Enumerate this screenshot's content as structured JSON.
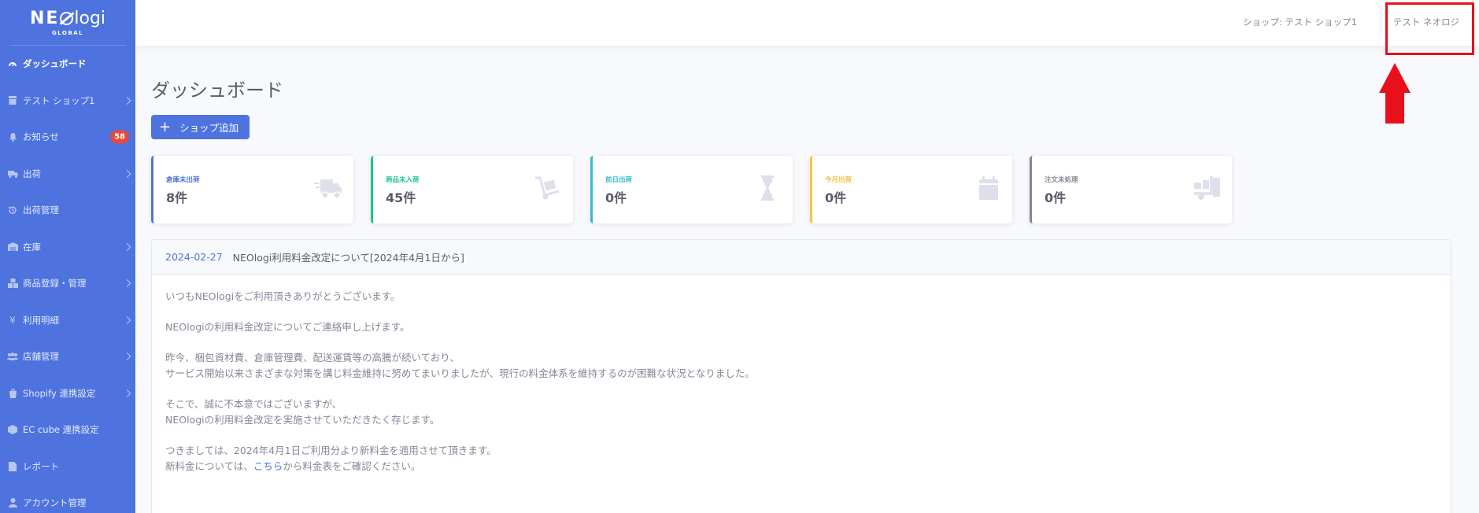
{
  "brand": {
    "logo_text": "NEOlogi",
    "sub": "GLOBAL"
  },
  "sidebar": {
    "items": [
      {
        "label": "ダッシュボード",
        "icon": "dashboard-icon"
      },
      {
        "label": "テスト ショップ1",
        "icon": "store-icon"
      },
      {
        "label": "お知らせ",
        "icon": "bell-icon",
        "badge": "58"
      },
      {
        "label": "出荷",
        "icon": "truck-icon"
      },
      {
        "label": "出荷管理",
        "icon": "history-icon"
      },
      {
        "label": "在庫",
        "icon": "warehouse-icon"
      },
      {
        "label": "商品登録・管理",
        "icon": "boxes-icon"
      },
      {
        "label": "利用明細",
        "icon": "yen-icon"
      },
      {
        "label": "店舗管理",
        "icon": "users-icon"
      },
      {
        "label": "Shopify 連携設定",
        "icon": "shopify-icon"
      },
      {
        "label": "EC cube 連携設定",
        "icon": "cube-icon"
      },
      {
        "label": "レポート",
        "icon": "file-icon"
      },
      {
        "label": "アカウント管理",
        "icon": "user-icon"
      }
    ]
  },
  "topbar": {
    "shop": "ショップ: テスト ショップ1",
    "user": "テスト ネオロジ"
  },
  "page": {
    "title": "ダッシュボード",
    "add_shop_label": "ショップ追加"
  },
  "cards": [
    {
      "label": "倉庫未出荷",
      "value": "8件",
      "color": "#4e73df",
      "icon": "truck-fast-icon"
    },
    {
      "label": "商品未入荷",
      "value": "45件",
      "color": "#1cc88a",
      "icon": "dolly-icon"
    },
    {
      "label": "前日出荷",
      "value": "0件",
      "color": "#36b9cc",
      "icon": "hourglass-icon"
    },
    {
      "label": "今月出荷",
      "value": "0件",
      "color": "#f6c23e",
      "icon": "calendar-icon"
    },
    {
      "label": "注文未処理",
      "value": "0件",
      "color": "#858796",
      "icon": "truck-loading-icon"
    }
  ],
  "news": {
    "date": "2024-02-27",
    "title": "NEOlogi利用料金改定について[2024年4月1日から]",
    "p1": "いつもNEOlogiをご利用頂きありがとうございます。",
    "p2": "NEOlogiの利用料金改定についてご連絡申し上げます。",
    "p3a": "昨今、梱包資材費、倉庫管理費、配送運賃等の高騰が続いており、",
    "p3b": "サービス開始以来さまざまな対策を講じ料金維持に努めてまいりましたが、現行の料金体系を維持するのが困難な状況となりました。",
    "p4a": "そこで、誠に不本意ではございますが、",
    "p4b": "NEOlogiの利用料金改定を実施させていただきたく存じます。",
    "p5a": "つきましては、2024年4月1日ご利用分より新料金を適用させて頂きます。",
    "p5b_pre": "新料金については、",
    "p5b_link": "こちら",
    "p5b_post": "から料金表をご確認ください。"
  },
  "annotation": {
    "highlight_color": "#e8101b"
  }
}
